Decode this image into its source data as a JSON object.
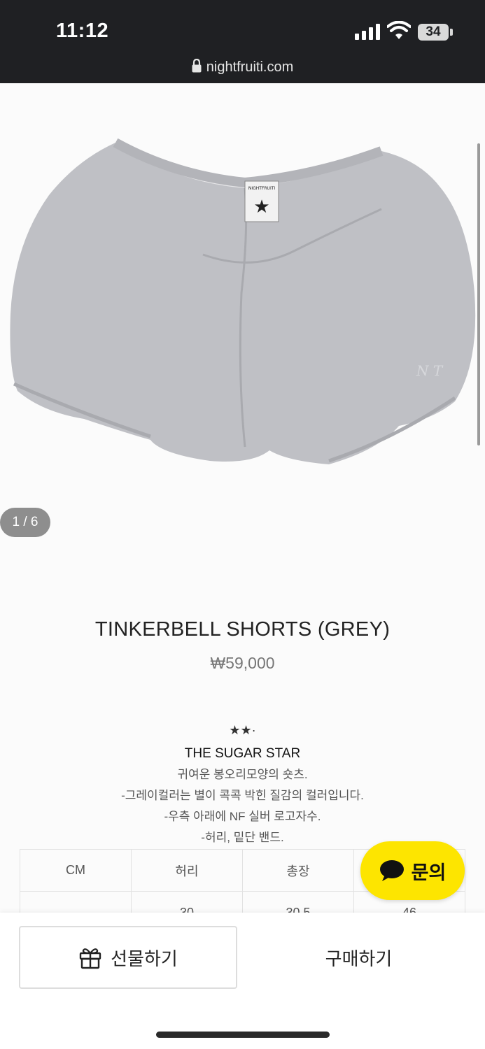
{
  "status_bar": {
    "time": "11:12",
    "battery": "34",
    "icons": [
      "signal-icon",
      "wifi-icon",
      "battery-icon"
    ]
  },
  "browser": {
    "url": "nightfruiti.com",
    "icon": "lock-icon"
  },
  "gallery": {
    "counter": "1 / 6",
    "waistband_label": "NIGHTFRUITI",
    "embroidery": "N T",
    "colors": {
      "fabric": "#bfc0c5",
      "lining": "#e8e8ea"
    }
  },
  "product": {
    "title": "TINKERBELL SHORTS (GREY)",
    "price": "₩59,000"
  },
  "description": {
    "stars": "★★·",
    "title": "THE SUGAR STAR",
    "lines": [
      "귀여운 봉오리모양의 숏츠.",
      "-그레이컬러는 별이 콕콕 박힌 질감의 컬러입니다.",
      "-우측 아래에 NF 실버 로고자수.",
      "-허리, 밑단 밴드."
    ]
  },
  "size_table": {
    "headers": [
      "CM",
      "허리",
      "총장",
      ""
    ],
    "rows": [
      [
        "",
        "30",
        "30.5",
        "46"
      ]
    ]
  },
  "inquiry": {
    "label": "문의",
    "icon": "chat-bubble-icon",
    "color": "#fde500"
  },
  "bottom_bar": {
    "gift_label": "선물하기",
    "gift_icon": "gift-icon",
    "buy_label": "구매하기"
  }
}
